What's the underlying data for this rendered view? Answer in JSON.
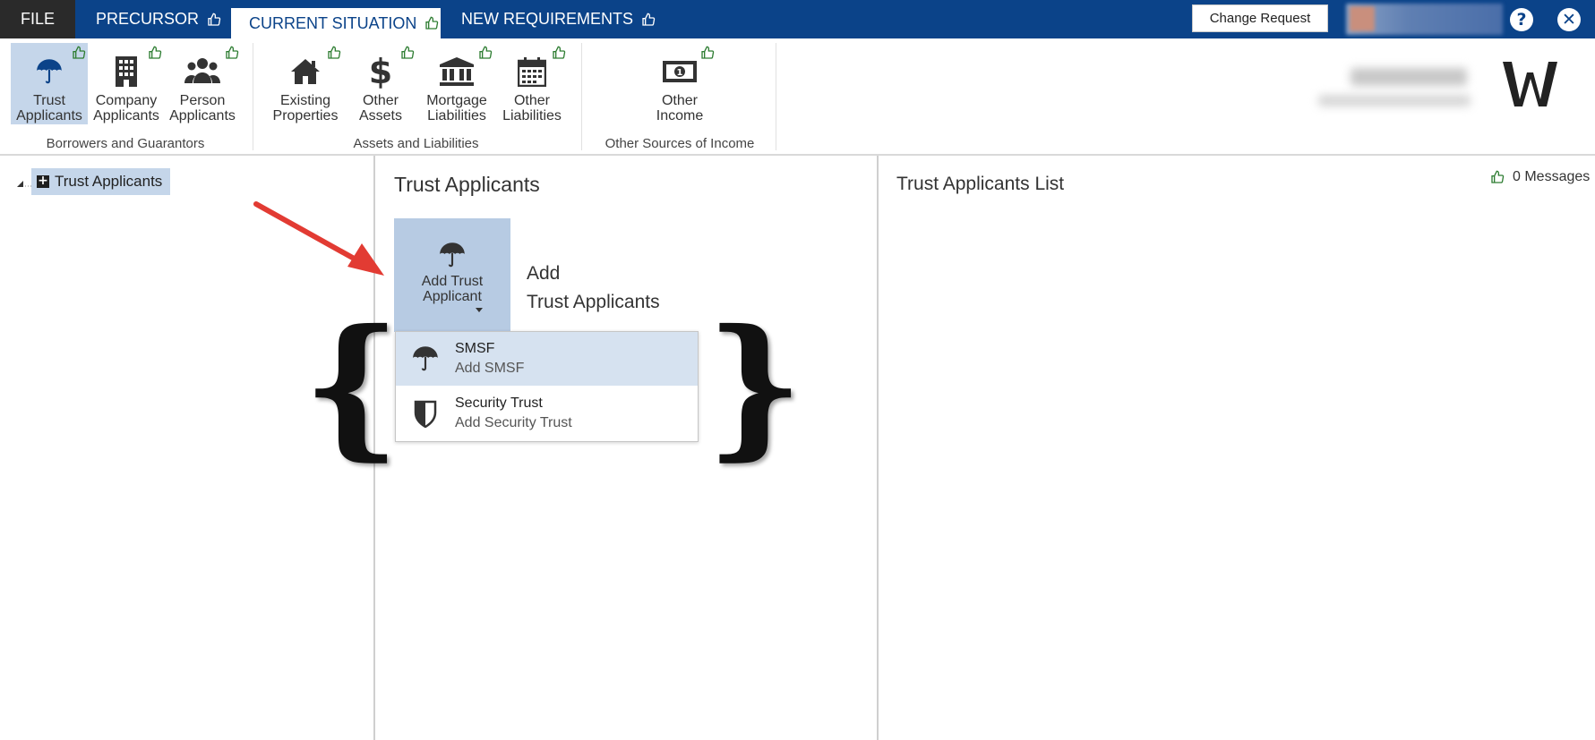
{
  "topbar": {
    "tabs": [
      {
        "label": "FILE"
      },
      {
        "label": "PRECURSOR"
      },
      {
        "label": "CURRENT SITUATION"
      },
      {
        "label": "NEW REQUIREMENTS"
      }
    ],
    "change_request_label": "Change Request",
    "colors": {
      "bar": "#0b4389",
      "file_tab": "#2a2a2a",
      "active_tab_text": "#0b4389"
    }
  },
  "ribbon": {
    "groups": [
      {
        "label": "Borrowers and Guarantors",
        "buttons": [
          {
            "line1": "Trust",
            "line2": "Applicants",
            "icon": "umbrella-icon",
            "active": true
          },
          {
            "line1": "Company",
            "line2": "Applicants",
            "icon": "building-icon"
          },
          {
            "line1": "Person",
            "line2": "Applicants",
            "icon": "people-icon"
          }
        ]
      },
      {
        "label": "Assets and Liabilities",
        "buttons": [
          {
            "line1": "Existing",
            "line2": "Properties",
            "icon": "house-icon"
          },
          {
            "line1": "Other",
            "line2": "Assets",
            "icon": "dollar-icon"
          },
          {
            "line1": "Mortgage",
            "line2": "Liabilities",
            "icon": "bank-icon"
          },
          {
            "line1": "Other",
            "line2": "Liabilities",
            "icon": "calendar-icon"
          }
        ]
      },
      {
        "label": "Other Sources of Income",
        "buttons": [
          {
            "line1": "Other",
            "line2": "Income",
            "icon": "banknote-icon"
          }
        ]
      }
    ]
  },
  "tree": {
    "node_label": "Trust Applicants"
  },
  "main": {
    "title": "Trust Applicants",
    "add_button": {
      "line1": "Add Trust",
      "line2": "Applicant"
    },
    "add_title": {
      "line1": "Add",
      "line2": "Trust Applicants"
    },
    "menu": [
      {
        "title": "SMSF",
        "subtitle": "Add SMSF",
        "icon": "umbrella-icon",
        "highlighted": true
      },
      {
        "title": "Security Trust",
        "subtitle": "Add Security Trust",
        "icon": "shield-icon"
      }
    ]
  },
  "list": {
    "title": "Trust Applicants List",
    "messages": "0 Messages"
  }
}
